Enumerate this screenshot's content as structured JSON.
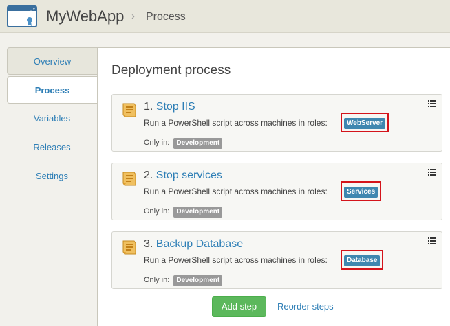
{
  "header": {
    "app_name": "MyWebApp",
    "breadcrumb": "Process",
    "separator": "›"
  },
  "sidebar": {
    "items": [
      {
        "label": "Overview"
      },
      {
        "label": "Process"
      },
      {
        "label": "Variables"
      },
      {
        "label": "Releases"
      },
      {
        "label": "Settings"
      }
    ],
    "active": "Process"
  },
  "main": {
    "title": "Deployment process",
    "steps": [
      {
        "number": "1.",
        "name": "Stop IIS",
        "description": "Run a PowerShell script across machines in roles:",
        "role": "WebServer",
        "only_in_label": "Only in:",
        "environment": "Development"
      },
      {
        "number": "2.",
        "name": "Stop services",
        "description": "Run a PowerShell script across machines in roles:",
        "role": "Services",
        "only_in_label": "Only in:",
        "environment": "Development"
      },
      {
        "number": "3.",
        "name": "Backup Database",
        "description": "Run a PowerShell script across machines in roles:",
        "role": "Database",
        "only_in_label": "Only in:",
        "environment": "Development"
      }
    ],
    "add_step_label": "Add step",
    "reorder_label": "Reorder steps"
  },
  "icons": {
    "app": "browser-window-icon",
    "step": "powershell-script-icon",
    "menu": "list-menu-icon"
  },
  "colors": {
    "accent": "#2f7fb6",
    "role_tag": "#3f87b0",
    "env_tag": "#999999",
    "highlight": "#d4141b",
    "add_button": "#5cb85c"
  }
}
